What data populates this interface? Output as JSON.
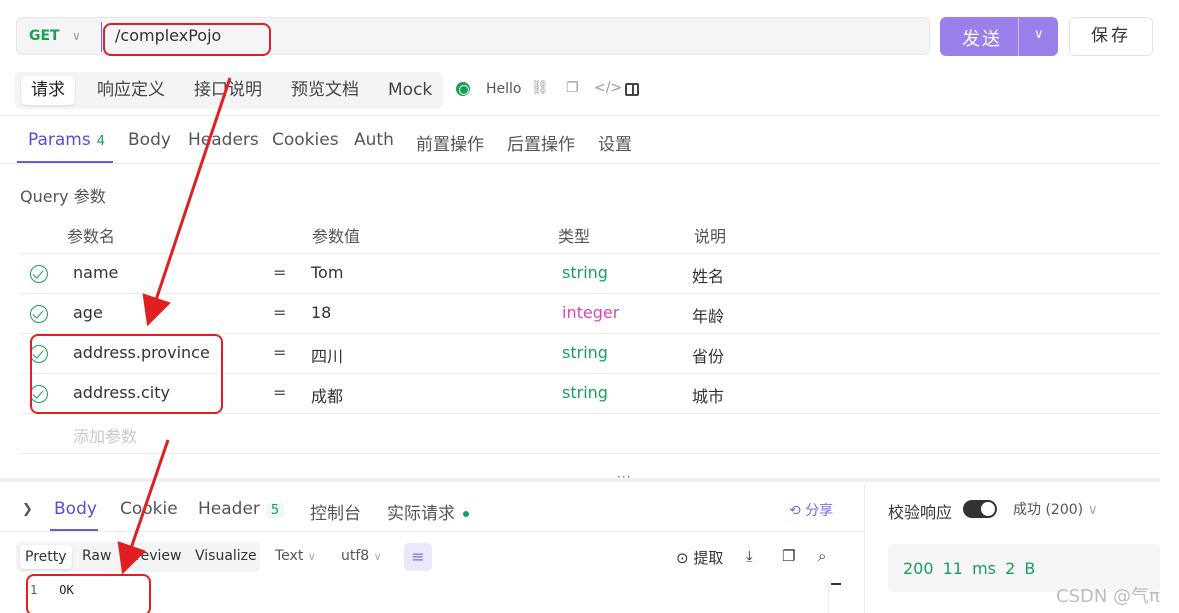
{
  "request": {
    "method": "GET",
    "url": "/complexPojo",
    "send_label": "发送",
    "save_label": "保存"
  },
  "top_tabs": [
    "请求",
    "响应定义",
    "接口说明",
    "预览文档",
    "Mock"
  ],
  "env_label": "Hello",
  "param_tabs": {
    "params_label": "Params",
    "params_count": "4",
    "others": [
      "Body",
      "Headers",
      "Cookies",
      "Auth",
      "前置操作",
      "后置操作",
      "设置"
    ]
  },
  "query": {
    "title": "Query 参数",
    "headers": [
      "参数名",
      "参数值",
      "类型",
      "说明"
    ],
    "rows": [
      {
        "name": "name",
        "eq": "=",
        "value": "Tom",
        "type": "string",
        "desc": "姓名"
      },
      {
        "name": "age",
        "eq": "=",
        "value": "18",
        "type": "integer",
        "desc": "年龄"
      },
      {
        "name": "address.province",
        "eq": "=",
        "value": "四川",
        "type": "string",
        "desc": "省份"
      },
      {
        "name": "address.city",
        "eq": "=",
        "value": "成都",
        "type": "string",
        "desc": "城市"
      }
    ],
    "add_placeholder": "添加参数"
  },
  "response": {
    "tabs": {
      "body": "Body",
      "cookie": "Cookie",
      "header": "Header",
      "header_count": "5",
      "console": "控制台",
      "actual": "实际请求"
    },
    "share": "分享",
    "validate": "校验响应",
    "status": "成功 (200)",
    "formats": [
      "Pretty",
      "Raw",
      "Preview",
      "Visualize"
    ],
    "text_dropdown": "Text",
    "encoding_dropdown": "utf8",
    "extract": "提取",
    "code_line_number": "1",
    "code_text": "OK",
    "meta": "200  11 ms  2 B"
  },
  "watermark": "CSDN @气π",
  "colors": {
    "accent": "#9b80ec",
    "green": "#18a058",
    "integer": "#d946b6",
    "annotation": "#e02020"
  }
}
